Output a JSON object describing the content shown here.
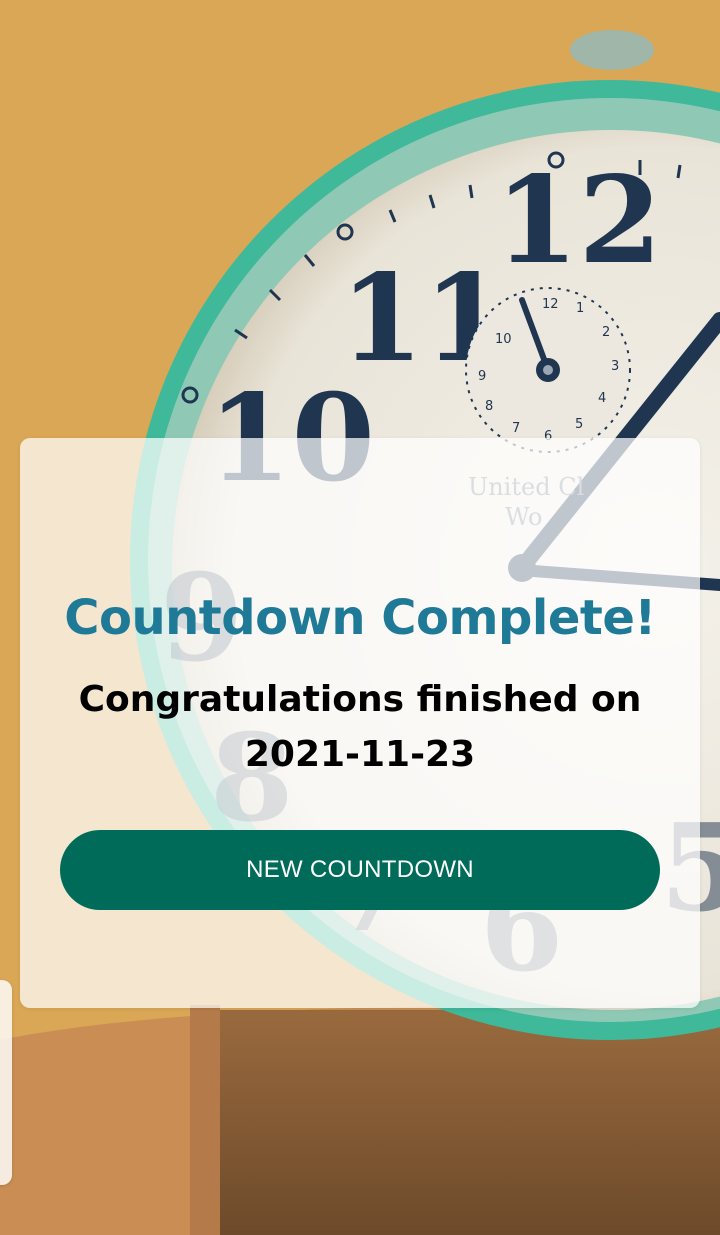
{
  "background": {
    "description_icon": "alarm-clock-photo",
    "numerals": [
      "12",
      "11",
      "10",
      "9",
      "8",
      "7",
      "6",
      "5"
    ],
    "dial_brand": [
      "United Cl",
      "Wo"
    ]
  },
  "dialog": {
    "title": "Countdown Complete!",
    "message_line1": "Congratulations finished on",
    "message_date": "2021-11-23",
    "button_label": "NEW COUNTDOWN"
  },
  "colors": {
    "title": "#1e7a96",
    "button": "#006b59",
    "background": "#d9a755",
    "clock_rim": "#3fb99a"
  }
}
